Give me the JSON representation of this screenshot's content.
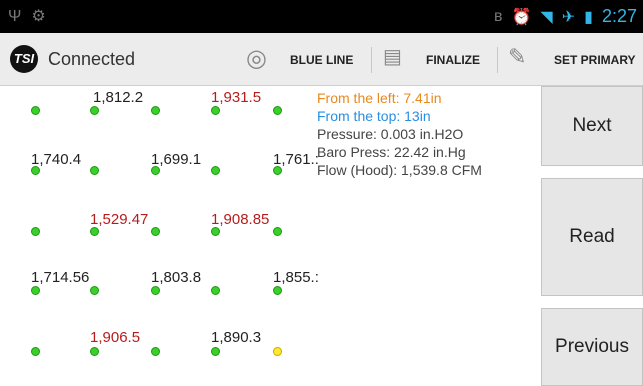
{
  "status_bar": {
    "time": "2:27"
  },
  "action_bar": {
    "logo_text": "TSI",
    "connection": "Connected",
    "blue_line": "BLUE LINE",
    "finalize": "FINALIZE",
    "set_primary": "SET PRIMARY"
  },
  "readings": [
    {
      "text": "1,812.2",
      "color": "#222222"
    },
    {
      "text": "1,931.5",
      "color": "#b71c1c"
    },
    {
      "text": "1,740.4",
      "color": "#222222"
    },
    {
      "text": "1,699.1",
      "color": "#222222"
    },
    {
      "text": "1,761.:",
      "color": "#222222"
    },
    {
      "text": "1,529.47",
      "color": "#b71c1c"
    },
    {
      "text": "1,908.85",
      "color": "#b71c1c"
    },
    {
      "text": "1,714.56",
      "color": "#222222"
    },
    {
      "text": "1,803.8",
      "color": "#222222"
    },
    {
      "text": "1,855.:",
      "color": "#222222"
    },
    {
      "text": "1,906.5",
      "color": "#b71c1c"
    },
    {
      "text": "1,890.3",
      "color": "#222222"
    }
  ],
  "info": {
    "from_left": "From the left: 7.41in",
    "from_top": "From the top: 13in",
    "pressure": "Pressure: 0.003 in.H2O",
    "baro": "Baro Press: 22.42 in.Hg",
    "flow": "Flow (Hood): 1,539.8 CFM"
  },
  "buttons": {
    "next": "Next",
    "read": "Read",
    "previous": "Previous"
  },
  "colors": {
    "accent": "#33b5e5",
    "point_ok": "#3ccf2b",
    "point_active": "#ffe82e",
    "red_value": "#b71c1c",
    "from_left": "#e98a20",
    "from_top": "#2a8ee0"
  }
}
